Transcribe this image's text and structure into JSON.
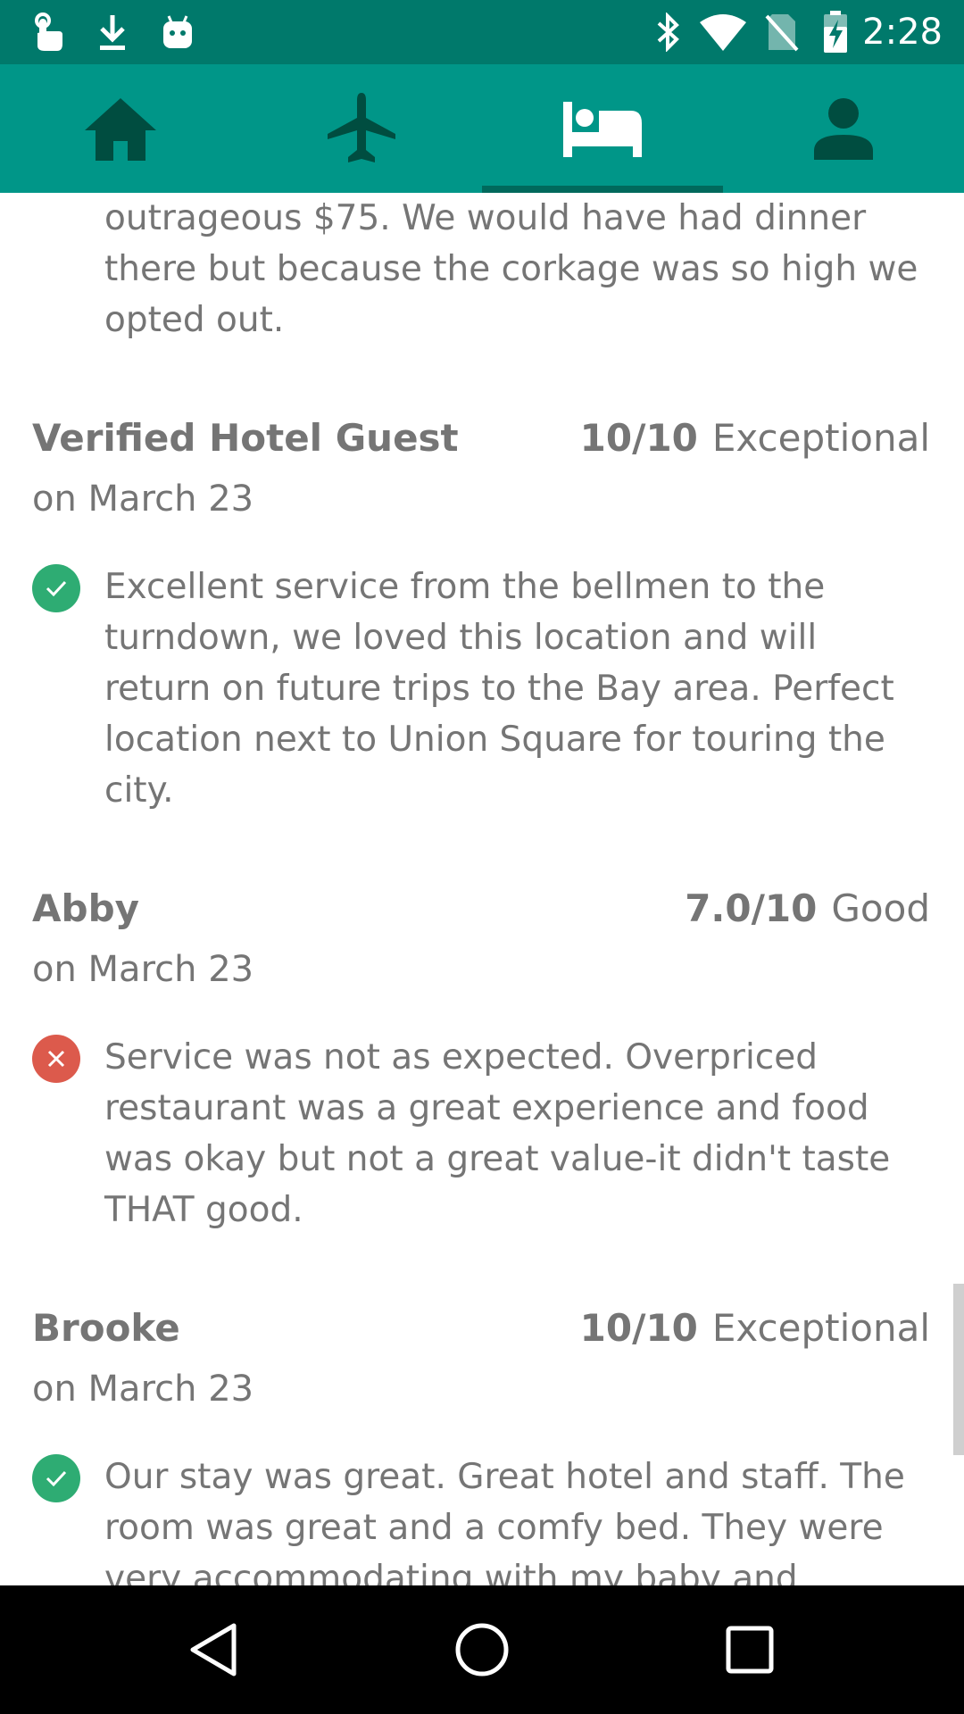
{
  "status_bar": {
    "time": "2:28",
    "icons": [
      "touch-icon",
      "download-icon",
      "android-icon",
      "bluetooth-icon",
      "wifi-icon",
      "no-sim-icon",
      "battery-charging-icon"
    ]
  },
  "tabs": [
    {
      "name": "home",
      "icon": "home-icon"
    },
    {
      "name": "flights",
      "icon": "airplane-icon"
    },
    {
      "name": "hotels",
      "icon": "bed-icon",
      "selected": true
    },
    {
      "name": "account",
      "icon": "person-icon"
    }
  ],
  "colors": {
    "status_bar": "#00796b",
    "tab_bar": "#009688",
    "indicator": "#00695c",
    "positive": "#2eac73",
    "negative": "#dc5a4c",
    "text": "#757575"
  },
  "reviews": {
    "partial_text": "outrageous $75. We would have had dinner there but because the corkage was so high we opted out.",
    "items": [
      {
        "reviewer": "Verified Hotel Guest",
        "score": "10/10",
        "rating_label": "Exceptional",
        "date": "on March 23",
        "sentiment": "positive",
        "text": "Excellent service from the bellmen to the turndown, we loved this location and will return on future trips to the Bay area. Perfect location next to Union Square for touring the city."
      },
      {
        "reviewer": "Abby",
        "score": "7.0/10",
        "rating_label": "Good",
        "date": "on March 23",
        "sentiment": "negative",
        "text": "Service was not as expected. Overpriced restaurant was a great experience and food was okay but not a great value-it didn't taste THAT good."
      },
      {
        "reviewer": "Brooke",
        "score": "10/10",
        "rating_label": "Exceptional",
        "date": "on March 23",
        "sentiment": "positive",
        "text": "Our stay was great. Great hotel and staff. The room was great and a comfy bed. They were very accommodating with my baby and"
      }
    ]
  },
  "nav_bar": {
    "buttons": [
      "back-icon",
      "home-circle-icon",
      "recents-icon"
    ]
  }
}
